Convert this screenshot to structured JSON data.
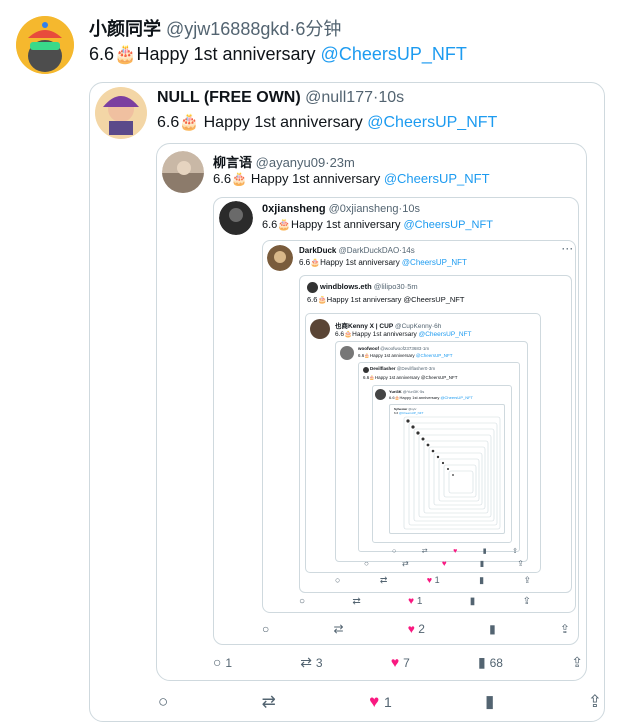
{
  "main": {
    "name": "小颜同学",
    "handle": "@yjw16888gkd",
    "dot": "·",
    "time": "6分钟",
    "text_prefix": "6.6",
    "cake": "🎂",
    "text_mid": "Happy 1st anniversary ",
    "mention": "@CheersUP_NFT"
  },
  "q1": {
    "name": "NULL (FREE OWN)",
    "handle": "@null177",
    "dot": "·",
    "time": "10s",
    "text_prefix": "6.6",
    "cake": "🎂",
    "text_mid": " Happy 1st anniversary ",
    "mention": "@CheersUP_NFT",
    "reply_count": "",
    "retweet_count": "",
    "like_count": "1",
    "view_count": ""
  },
  "q2": {
    "name": "柳言语",
    "handle": "@ayanyu09",
    "dot": "·",
    "time": "23m",
    "text_prefix": "6.6",
    "cake": "🎂",
    "text_mid": " Happy 1st anniversary ",
    "mention": "@CheersUP_NFT",
    "reply_count": "1",
    "retweet_count": "3",
    "like_count": "7",
    "view_count": "68"
  },
  "q3": {
    "name": "0xjiansheng",
    "handle": "@0xjiansheng",
    "dot": "·",
    "time": "10s",
    "text_prefix": "6.6",
    "cake": "🎂",
    "text_mid": "Happy 1st anniversary ",
    "mention": "@CheersUP_NFT",
    "like_count": "2"
  },
  "q4": {
    "name": "DarkDuck",
    "handle": "@DarkDuckDAO",
    "dot": "·",
    "time": "14s",
    "text_prefix": "6.6",
    "cake": "🎂",
    "text_mid": "Happy 1st anniversary ",
    "mention": "@CheersUP_NFT",
    "more": "···",
    "like_count": "1"
  },
  "q5": {
    "name": "windblows.eth",
    "handle": "@lilipo30",
    "dot": "·",
    "time": "5m",
    "text_prefix": "6.6",
    "cake": "🎂",
    "text_mid": "Happy 1st anniversary ",
    "mention": "@CheersUP_NFT",
    "like_count": "1"
  },
  "q6": {
    "name": "也商Kenny X | CUP",
    "handle": "@CupKenny",
    "dot": "·",
    "time": "6h",
    "text_prefix": "6.6",
    "cake": "🎂",
    "text_mid": "Happy 1st anniversary ",
    "mention": "@CheersUP_NFT",
    "like_count": "1"
  },
  "q7": {
    "name": "woofwoof",
    "handle": "@woofwoof2373683",
    "dot": "·",
    "time": "1m",
    "text_prefix": "6.6",
    "cake": "🎂",
    "text_mid": "Happy 1st anniversary ",
    "mention": "@CheersUP_NFT"
  },
  "q8": {
    "name": "Devilflasher",
    "handle": "@Devilflasher0",
    "dot": "·",
    "time": "3m",
    "text_prefix": "6.6",
    "cake": "🎂",
    "text_mid": "Happy 1st anniversary ",
    "mention": "@CheersUP_NFT"
  },
  "q9": {
    "name": "Yuri3K",
    "handle": "@Yuri3K",
    "dot": "·",
    "time": "5s",
    "text_prefix": "6.6",
    "cake": "🎂",
    "text_mid": "Happy 1st anniversary ",
    "mention": "@CheersUP_NFT"
  },
  "q10": {
    "name": "Sylvester",
    "handle": "@sylv",
    "text_prefix": "6.6",
    "mention": "@CheersUP_NFT"
  },
  "icons": {
    "reply": "reply-icon",
    "retweet": "retweet-icon",
    "like": "heart-icon",
    "views": "views-icon",
    "share": "share-icon"
  },
  "colors": {
    "link": "#1d9bf0",
    "like": "#f91880",
    "muted": "#536471",
    "border": "#cfd9de"
  }
}
